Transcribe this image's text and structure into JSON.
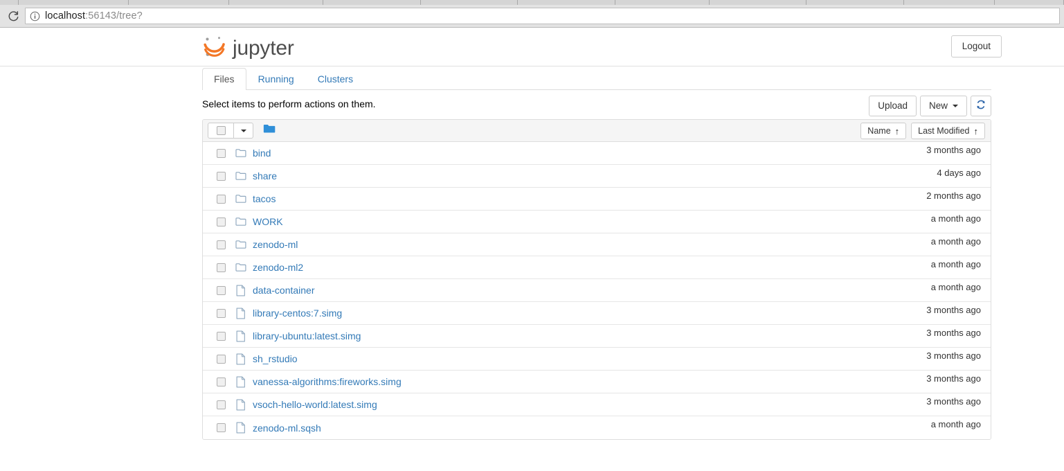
{
  "browser": {
    "reload_icon": "reload-icon",
    "info_icon": "info-circle-icon",
    "url_host": "localhost",
    "url_rest": ":56143/tree?"
  },
  "header": {
    "logo_icon": "jupyter-logo-icon",
    "brand": "jupyter",
    "logout_label": "Logout"
  },
  "tabs": [
    {
      "label": "Files",
      "active": true
    },
    {
      "label": "Running",
      "active": false
    },
    {
      "label": "Clusters",
      "active": false
    }
  ],
  "action_row": {
    "hint": "Select items to perform actions on them.",
    "upload_label": "Upload",
    "new_label": "New",
    "refresh_icon": "refresh-icon"
  },
  "list_toolbar": {
    "select_all_icon": "checkbox-icon",
    "select_dropdown_icon": "chevron-down-icon",
    "breadcrumb_icon": "folder-filled-icon",
    "sort_name_label": "Name",
    "sort_modified_label": "Last Modified",
    "sort_arrow": "↑"
  },
  "colors": {
    "link": "#337ab7",
    "brand_orange": "#f37726",
    "brand_gray": "#4e4e4e",
    "panel_border": "#dddddd",
    "toolbar_bg": "#f5f5f5",
    "folder_icon": "#8fa8bf",
    "breadcrumb_folder": "#2f8fd8"
  },
  "files": [
    {
      "name": "bind",
      "type": "directory",
      "modified": "3 months ago"
    },
    {
      "name": "share",
      "type": "directory",
      "modified": "4 days ago"
    },
    {
      "name": "tacos",
      "type": "directory",
      "modified": "2 months ago"
    },
    {
      "name": "WORK",
      "type": "directory",
      "modified": "a month ago"
    },
    {
      "name": "zenodo-ml",
      "type": "directory",
      "modified": "a month ago"
    },
    {
      "name": "zenodo-ml2",
      "type": "directory",
      "modified": "a month ago"
    },
    {
      "name": "data-container",
      "type": "file",
      "modified": "a month ago"
    },
    {
      "name": "library-centos:7.simg",
      "type": "file",
      "modified": "3 months ago"
    },
    {
      "name": "library-ubuntu:latest.simg",
      "type": "file",
      "modified": "3 months ago"
    },
    {
      "name": "sh_rstudio",
      "type": "file",
      "modified": "3 months ago"
    },
    {
      "name": "vanessa-algorithms:fireworks.simg",
      "type": "file",
      "modified": "3 months ago"
    },
    {
      "name": "vsoch-hello-world:latest.simg",
      "type": "file",
      "modified": "3 months ago"
    },
    {
      "name": "zenodo-ml.sqsh",
      "type": "file",
      "modified": "a month ago"
    }
  ]
}
